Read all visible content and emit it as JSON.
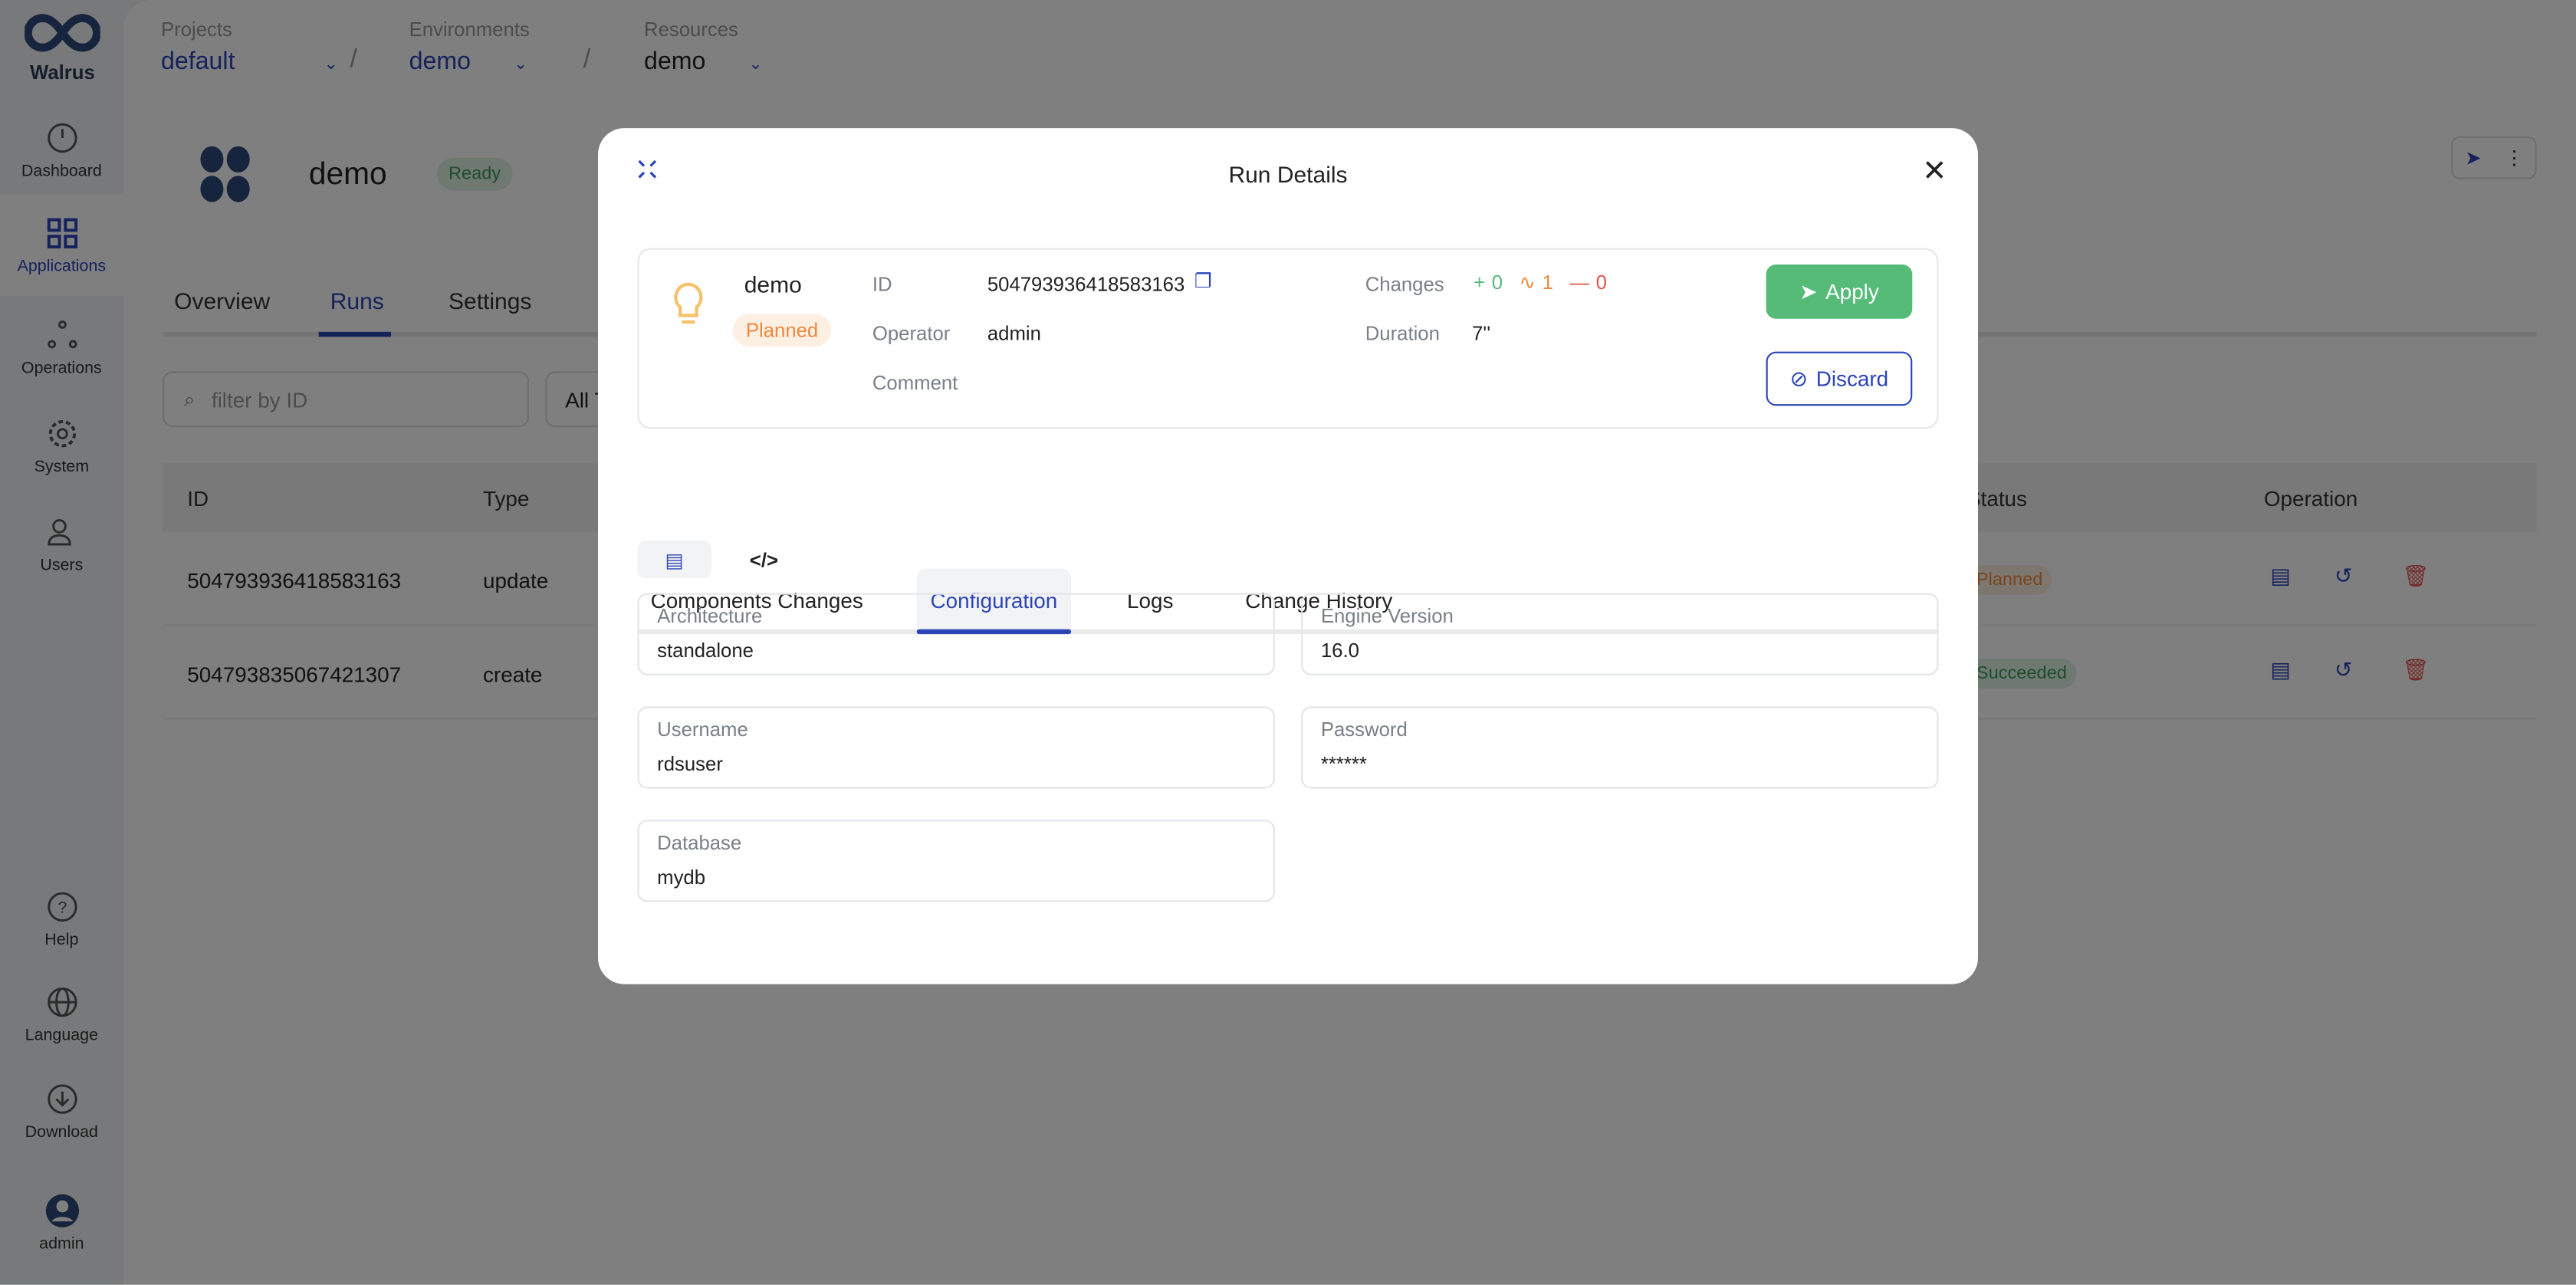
{
  "app": {
    "logo": "Walrus"
  },
  "sidebar": {
    "items": [
      {
        "label": "Dashboard",
        "icon": "dashboard-icon"
      },
      {
        "label": "Applications",
        "icon": "grid-icon"
      },
      {
        "label": "Operations",
        "icon": "operations-icon"
      },
      {
        "label": "System",
        "icon": "gear-icon"
      },
      {
        "label": "Users",
        "icon": "users-icon"
      }
    ],
    "bottom": [
      {
        "label": "Help",
        "icon": "help-icon"
      },
      {
        "label": "Language",
        "icon": "globe-icon"
      },
      {
        "label": "Download",
        "icon": "download-icon"
      },
      {
        "label": "admin",
        "icon": "avatar-icon"
      }
    ]
  },
  "breadcrumb": [
    {
      "label": "Projects",
      "value": "default"
    },
    {
      "label": "Environments",
      "value": "demo"
    },
    {
      "label": "Resources",
      "value": "demo"
    }
  ],
  "resource": {
    "name": "demo",
    "status": "Ready"
  },
  "page_tabs": [
    "Overview",
    "Runs",
    "Settings"
  ],
  "filter": {
    "placeholder": "filter by ID",
    "type_select": "All T"
  },
  "table": {
    "headers": [
      "ID",
      "Type",
      "Status",
      "Operation"
    ],
    "rows": [
      {
        "id": "504793936418583163",
        "type": "update",
        "status": "Planned"
      },
      {
        "id": "504793835067421307",
        "type": "create",
        "status": "Succeeded"
      }
    ]
  },
  "modal": {
    "title": "Run Details",
    "run": {
      "name": "demo",
      "status": "Planned",
      "id_label": "ID",
      "id": "504793936418583163",
      "operator_label": "Operator",
      "operator": "admin",
      "comment_label": "Comment",
      "changes_label": "Changes",
      "added": "0",
      "modified": "1",
      "deleted": "0",
      "duration_label": "Duration",
      "duration": "7''"
    },
    "apply": "Apply",
    "discard": "Discard",
    "tabs": [
      "Components Changes",
      "Configuration",
      "Logs",
      "Change History"
    ],
    "fields": [
      {
        "label": "Architecture",
        "value": "standalone"
      },
      {
        "label": "Engine Version",
        "value": "16.0"
      },
      {
        "label": "Username",
        "value": "rdsuser"
      },
      {
        "label": "Password",
        "value": "******"
      },
      {
        "label": "Database",
        "value": "mydb"
      }
    ]
  },
  "colors": {
    "accent": "#2b45b7",
    "success": "#55bb77",
    "warning": "#f0883e",
    "danger": "#e5534b"
  }
}
